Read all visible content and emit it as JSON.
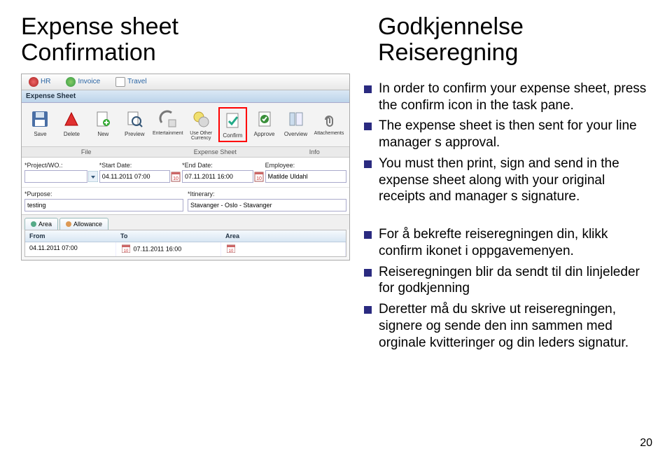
{
  "titles": {
    "left_line1": "Expense sheet",
    "left_line2": "Confirmation",
    "right_line1": "Godkjennelse",
    "right_line2": "Reiseregning"
  },
  "tabs": {
    "hr": "HR",
    "invoice": "Invoice",
    "travel": "Travel"
  },
  "expense_header": "Expense Sheet",
  "toolbar": {
    "save": "Save",
    "delete": "Delete",
    "new": "New",
    "preview": "Preview",
    "entertainment": "Entertainment",
    "useother": "Use Other Currency",
    "confirm": "Confirm",
    "approve": "Approve",
    "overview": "Overview",
    "attachments": "Attachements"
  },
  "groups": {
    "file": "File",
    "expense": "Expense Sheet",
    "info": "Info"
  },
  "form": {
    "project_label": "*Project/WO.:",
    "project_value": "",
    "start_label": "*Start Date:",
    "start_value": "04.11.2011 07:00",
    "end_label": "*End Date:",
    "end_value": "07.11.2011 16:00",
    "employee_label": "Employee:",
    "employee_value": "Matilde Uldahl",
    "purpose_label": "*Purpose:",
    "purpose_value": "testing",
    "itinerary_label": "*Itinerary:",
    "itinerary_value": "Stavanger - Oslo - Stavanger"
  },
  "subtabs": {
    "area": "Area",
    "allowance": "Allowance"
  },
  "grid": {
    "from_hdr": "From",
    "to_hdr": "To",
    "area_hdr": "Area",
    "from_val": "04.11.2011 07:00",
    "to_val": "07.11.2011 16:00",
    "area_val": ""
  },
  "bullets_en": [
    "In order to confirm your expense sheet, press the confirm icon in the task pane.",
    "The expense sheet is then sent for your line manager s approval.",
    "You must then print, sign and send in the expense sheet along with your original receipts and manager s signature."
  ],
  "bullets_no": [
    "For å bekrefte reiseregningen din, klikk confirm ikonet i oppgavemenyen.",
    "Reiseregningen blir da sendt til din linjeleder for godkjenning",
    "Deretter må du skrive ut reiseregningen, signere og sende den inn sammen med orginale kvitteringer og din leders signatur."
  ],
  "page_number": "20"
}
